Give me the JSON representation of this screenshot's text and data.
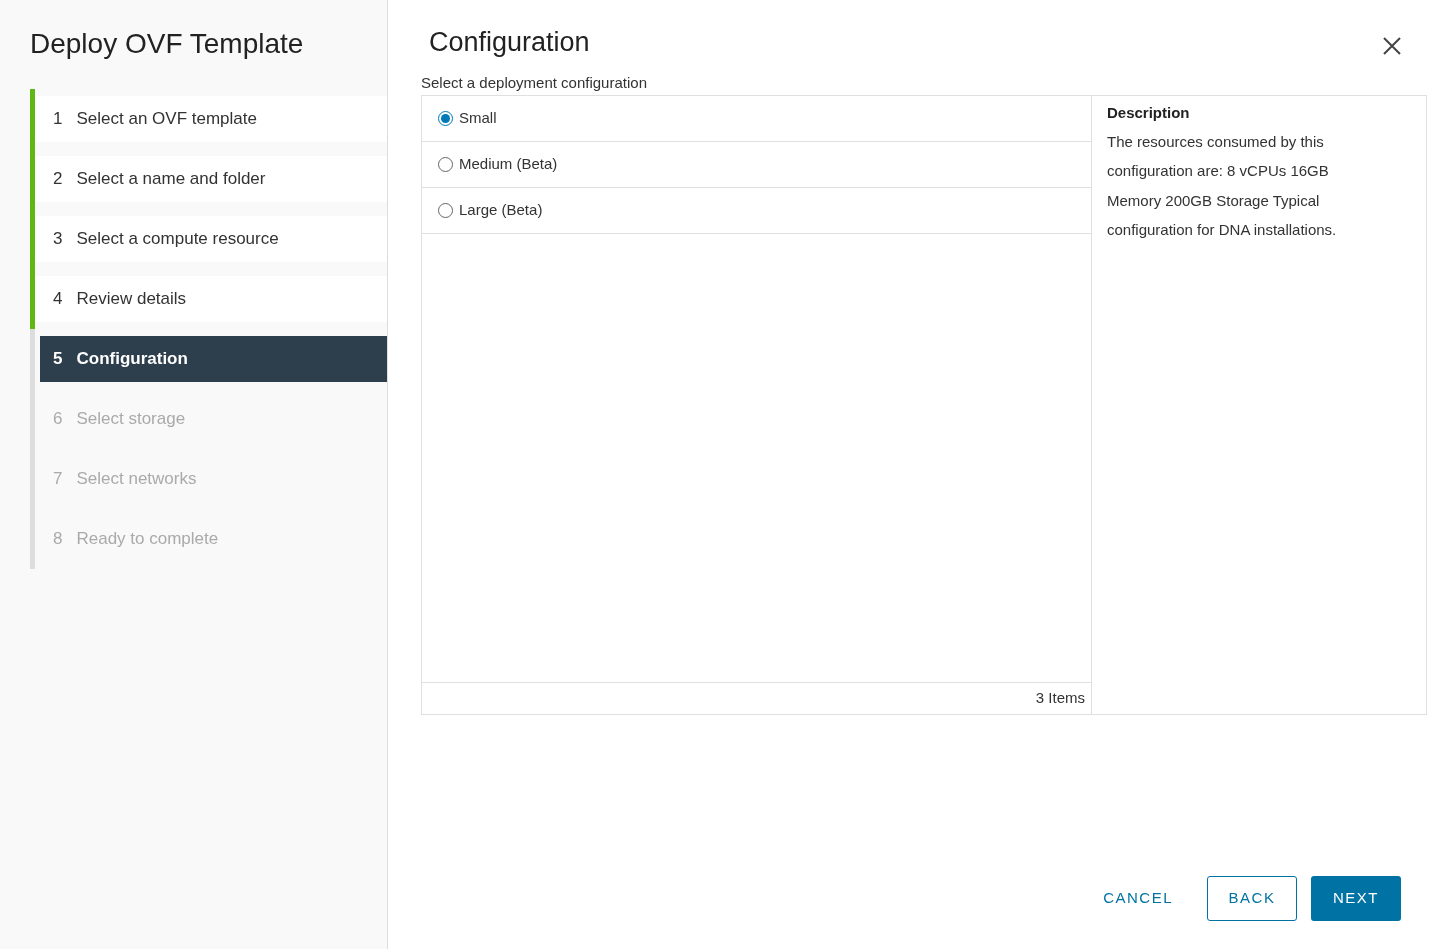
{
  "sidebar": {
    "title": "Deploy OVF Template",
    "steps": [
      {
        "number": "1",
        "label": "Select an OVF template",
        "kind": "done",
        "selected": false
      },
      {
        "number": "2",
        "label": "Select a name and folder",
        "kind": "done",
        "selected": false
      },
      {
        "number": "3",
        "label": "Select a compute resource",
        "kind": "done",
        "selected": false
      },
      {
        "number": "4",
        "label": "Review details",
        "kind": "done",
        "selected": false
      },
      {
        "number": "5",
        "label": "Configuration",
        "kind": "current",
        "selected": true
      },
      {
        "number": "6",
        "label": "Select storage",
        "kind": "pending",
        "selected": false
      },
      {
        "number": "7",
        "label": "Select networks",
        "kind": "pending",
        "selected": false
      },
      {
        "number": "8",
        "label": "Ready to complete",
        "kind": "pending",
        "selected": false
      }
    ]
  },
  "main": {
    "title": "Configuration",
    "subtitle": "Select a deployment configuration",
    "options": [
      {
        "label": "Small",
        "selected": true
      },
      {
        "label": "Medium (Beta)",
        "selected": false
      },
      {
        "label": "Large (Beta)",
        "selected": false
      }
    ],
    "footer": "3 Items",
    "description": {
      "heading": "Description",
      "text": "The resources consumed by this configuration are: 8 vCPUs 16GB Memory 200GB Storage Typical configuration for DNA installations."
    }
  },
  "buttons": [
    {
      "label": "CANCEL",
      "kind": "flat"
    },
    {
      "label": "BACK",
      "kind": "outline"
    },
    {
      "label": "NEXT",
      "kind": "primary"
    }
  ]
}
